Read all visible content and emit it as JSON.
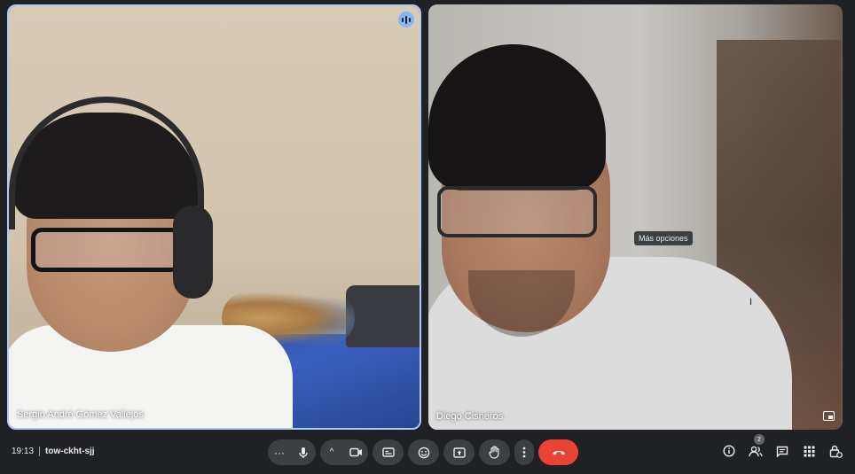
{
  "participants": [
    {
      "name": "Sergio André Gómez Vallejos",
      "speaking": true
    },
    {
      "name": "Diego Cisneros",
      "speaking": false
    }
  ],
  "tooltip": "Más opciones",
  "cursor_glyph": "I",
  "meeting": {
    "time": "19:13",
    "code": "tow-ckht-sjj"
  },
  "controls": {
    "more_audio": "···",
    "caret": "^",
    "people_count": "2"
  },
  "icons": {
    "mic": "mic-icon",
    "camera": "camera-icon",
    "captions": "captions-icon",
    "emoji": "emoji-icon",
    "present": "present-icon",
    "hand": "raise-hand-icon",
    "more": "more-vert-icon",
    "end": "end-call-icon",
    "info": "info-icon",
    "people": "people-icon",
    "chat": "chat-icon",
    "activities": "activities-icon",
    "host": "host-controls-icon",
    "expand": "expand-icon",
    "speaking": "speaking-indicator-icon"
  },
  "colors": {
    "end_call": "#ea4335",
    "speaking_border": "#aecbfa",
    "bar": "#202124",
    "button": "#3c4043"
  }
}
